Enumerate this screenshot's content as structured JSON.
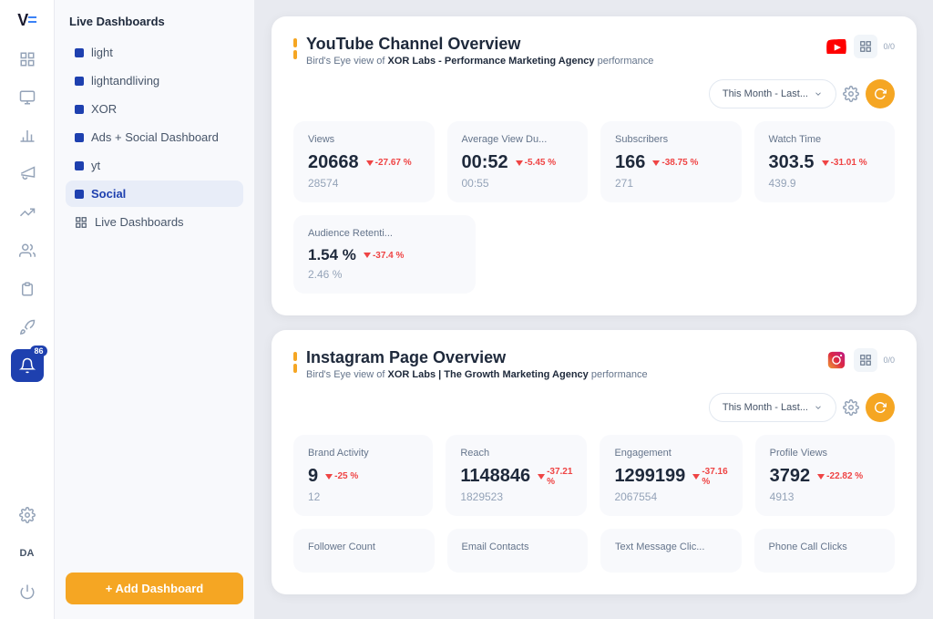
{
  "app": {
    "logo": "VE",
    "logo_accent": "="
  },
  "rail": {
    "icons": [
      {
        "name": "dashboard-icon",
        "symbol": "⊞",
        "active": false
      },
      {
        "name": "chart-icon",
        "symbol": "📊",
        "active": false
      },
      {
        "name": "megaphone-icon",
        "symbol": "📢",
        "active": false
      },
      {
        "name": "bar-chart-icon",
        "symbol": "📈",
        "active": false
      },
      {
        "name": "users-icon",
        "symbol": "👥",
        "active": false
      },
      {
        "name": "clipboard-icon",
        "symbol": "📋",
        "active": false
      },
      {
        "name": "rocket-icon",
        "symbol": "🚀",
        "active": false
      },
      {
        "name": "notification-icon",
        "symbol": "🔔",
        "badge": "86",
        "active": true
      },
      {
        "name": "settings-cog-icon",
        "symbol": "⚙️",
        "active": false
      },
      {
        "name": "da-label",
        "symbol": "DA",
        "active": false
      },
      {
        "name": "power-icon",
        "symbol": "⏻",
        "active": false
      }
    ]
  },
  "sidebar": {
    "title": "Live Dashboards",
    "items": [
      {
        "label": "light",
        "active": false
      },
      {
        "label": "lightandliving",
        "active": false
      },
      {
        "label": "XOR",
        "active": false
      },
      {
        "label": "Ads + Social Dashboard",
        "active": false
      },
      {
        "label": "yt",
        "active": false
      },
      {
        "label": "Social",
        "active": true
      },
      {
        "label": "Live Dashboards",
        "active": false
      }
    ],
    "add_button": "+ Add Dashboard"
  },
  "youtube_card": {
    "title": "YouTube Channel Overview",
    "subtitle_pre": "Bird's Eye view of ",
    "subtitle_brand": "XOR Labs - Performance Marketing Agency",
    "subtitle_post": " performance",
    "platform_icon": "▶",
    "date_filter": "This Month - Last...",
    "metrics": [
      {
        "label": "Views",
        "current": "20668",
        "change": "-27.67 %",
        "change_dir": "down",
        "previous": "28574"
      },
      {
        "label": "Average View Du...",
        "current": "00:52",
        "change": "-5.45 %",
        "change_dir": "down",
        "previous": "00:55"
      },
      {
        "label": "Subscribers",
        "current": "166",
        "change": "-38.75 %",
        "change_dir": "down",
        "previous": "271"
      },
      {
        "label": "Watch Time",
        "current": "303.5",
        "change": "-31.01 %",
        "change_dir": "down",
        "previous": "439.9"
      }
    ],
    "metrics_row2": [
      {
        "label": "Audience Retenti...",
        "current": "1.54 %",
        "change": "-37.4 %",
        "change_dir": "down",
        "previous": "2.46 %"
      }
    ]
  },
  "instagram_card": {
    "title": "Instagram Page Overview",
    "subtitle_pre": "Bird's Eye view of ",
    "subtitle_brand": "XOR Labs | The Growth Marketing Agency",
    "subtitle_post": " performance",
    "platform_icon": "📷",
    "date_filter": "This Month - Last...",
    "metrics": [
      {
        "label": "Brand Activity",
        "current": "9",
        "change": "-25 %",
        "change_dir": "down",
        "previous": "12"
      },
      {
        "label": "Reach",
        "current": "1148846",
        "change": "-37.21 %",
        "change_dir": "down",
        "previous": "1829523"
      },
      {
        "label": "Engagement",
        "current": "1299199",
        "change": "-37.16 %",
        "change_dir": "down",
        "previous": "2067554"
      },
      {
        "label": "Profile Views",
        "current": "3792",
        "change": "-22.82 %",
        "change_dir": "down",
        "previous": "4913"
      }
    ],
    "metrics_row2_labels": [
      "Follower Count",
      "Email Contacts",
      "Text Message Clic...",
      "Phone Call Clicks"
    ]
  }
}
